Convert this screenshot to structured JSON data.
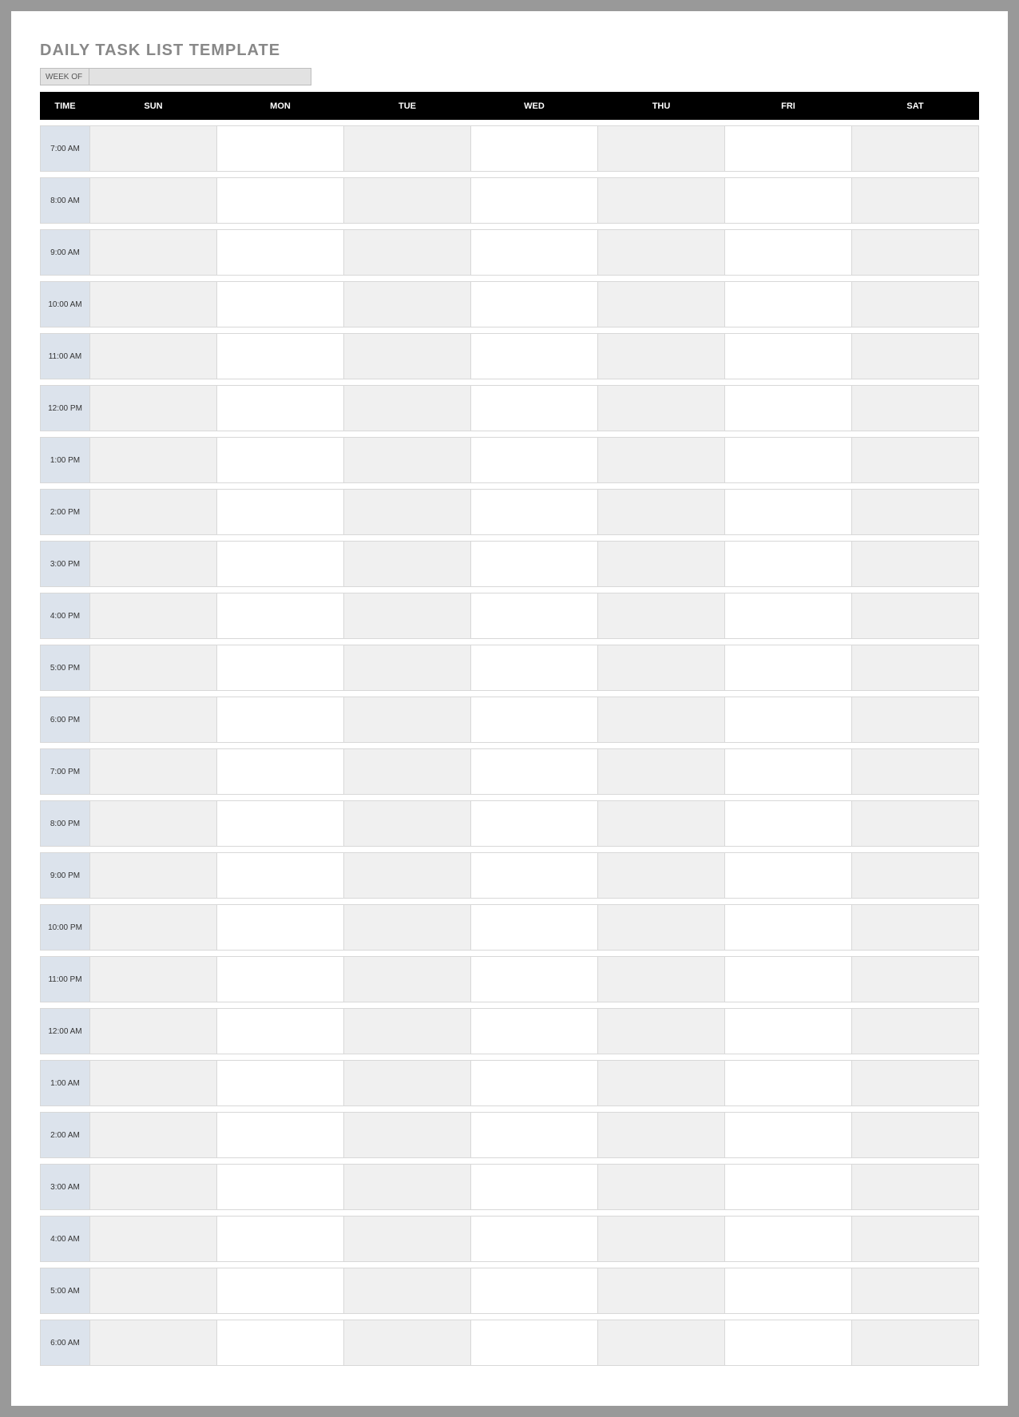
{
  "title": "DAILY TASK LIST TEMPLATE",
  "weekof_label": "WEEK OF",
  "weekof_value": "",
  "headers": {
    "time": "TIME",
    "days": [
      "SUN",
      "MON",
      "TUE",
      "WED",
      "THU",
      "FRI",
      "SAT"
    ]
  },
  "shaded_days": [
    0,
    2,
    4,
    6
  ],
  "times": [
    "7:00 AM",
    "8:00 AM",
    "9:00 AM",
    "10:00 AM",
    "11:00 AM",
    "12:00 PM",
    "1:00 PM",
    "2:00 PM",
    "3:00 PM",
    "4:00 PM",
    "5:00 PM",
    "6:00 PM",
    "7:00 PM",
    "8:00 PM",
    "9:00 PM",
    "10:00 PM",
    "11:00 PM",
    "12:00 AM",
    "1:00 AM",
    "2:00 AM",
    "3:00 AM",
    "4:00 AM",
    "5:00 AM",
    "6:00 AM"
  ]
}
